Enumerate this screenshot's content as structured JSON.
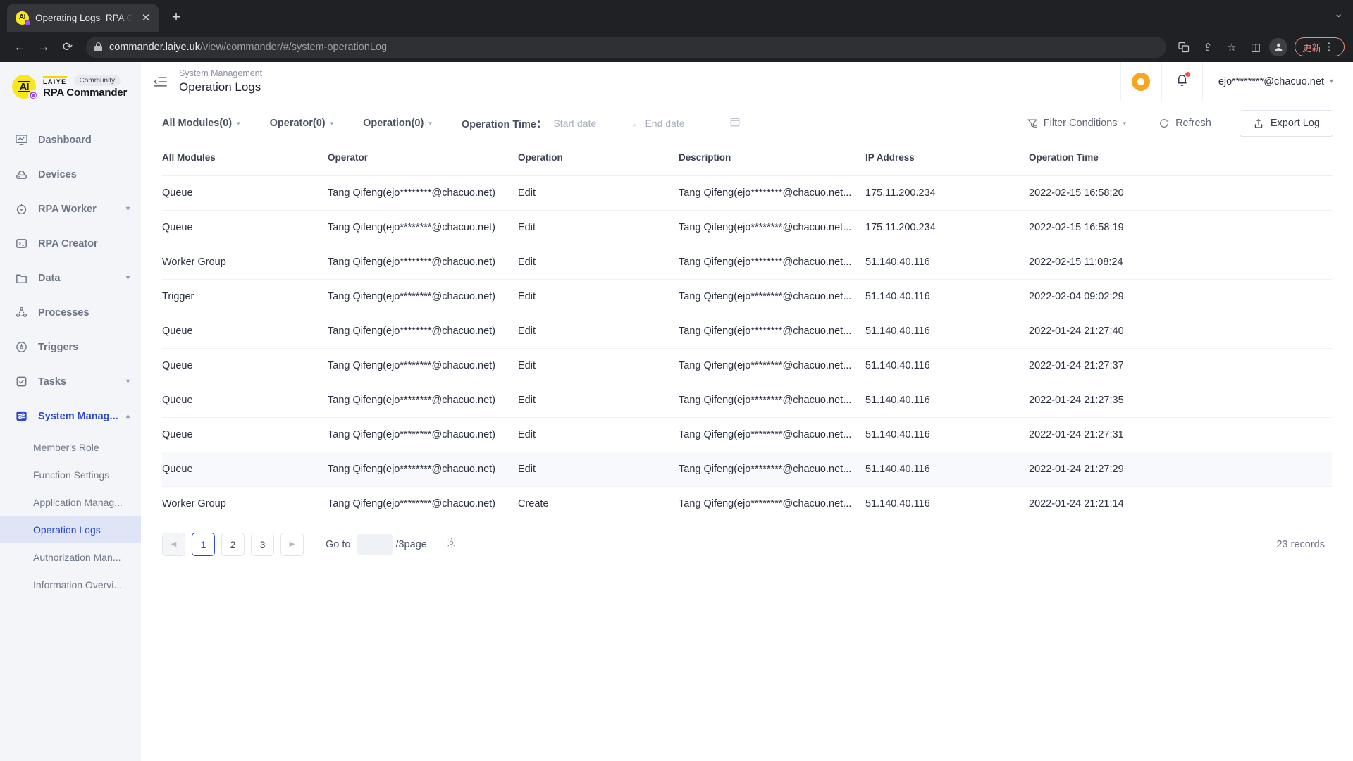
{
  "browser": {
    "tab_title": "Operating Logs_RPA Command",
    "tab_close": "✕",
    "new_tab": "+",
    "window_collapse": "⌄",
    "back": "←",
    "forward": "→",
    "reload": "⟳",
    "url_domain": "commander.laiye.uk",
    "url_path": "/view/commander/#/system-operationLog",
    "translate_icon": "translate-icon",
    "share_icon": "⇪",
    "bookmark_icon": "☆",
    "sidepanel_icon": "◫",
    "profile_icon": "●",
    "update_label": "更新",
    "menu_icon": "⋮"
  },
  "sidebar": {
    "logo": {
      "mark": "AI",
      "vendor": "LAIYE",
      "edition": "Community",
      "product": "RPA Commander"
    },
    "items": [
      {
        "label": "Dashboard",
        "icon": "dashboard-icon",
        "expandable": false,
        "active": false
      },
      {
        "label": "Devices",
        "icon": "device-icon",
        "expandable": false,
        "active": false
      },
      {
        "label": "RPA Worker",
        "icon": "robot-icon",
        "expandable": true,
        "active": false
      },
      {
        "label": "RPA Creator",
        "icon": "terminal-icon",
        "expandable": false,
        "active": false
      },
      {
        "label": "Data",
        "icon": "folder-icon",
        "expandable": true,
        "active": false
      },
      {
        "label": "Processes",
        "icon": "process-icon",
        "expandable": false,
        "active": false
      },
      {
        "label": "Triggers",
        "icon": "trigger-icon",
        "expandable": false,
        "active": false
      },
      {
        "label": "Tasks",
        "icon": "task-icon",
        "expandable": true,
        "active": false
      },
      {
        "label": "System Manag...",
        "icon": "settings-sliders-icon",
        "expandable": true,
        "active": true
      }
    ],
    "subitems": [
      {
        "label": "Member's Role",
        "active": false
      },
      {
        "label": "Function Settings",
        "active": false
      },
      {
        "label": "Application Manag...",
        "active": false
      },
      {
        "label": "Operation Logs",
        "active": true
      },
      {
        "label": "Authorization Man...",
        "active": false
      },
      {
        "label": "Information Overvi...",
        "active": false
      }
    ]
  },
  "header": {
    "breadcrumb": "System Management",
    "title": "Operation Logs",
    "collapse_icon": "collapse-sidebar-icon",
    "bulb_icon": "lightbulb-icon",
    "bell_icon": "🔔",
    "user_email": "ejo********@chacuo.net",
    "user_caret": "⌄"
  },
  "filters": {
    "modules": {
      "label": "All Modules(0)",
      "caret": "⌄"
    },
    "operator": {
      "label": "Operator(0)",
      "caret": "⌄"
    },
    "operation": {
      "label": "Operation(0)",
      "caret": "⌄"
    },
    "time_label": "Operation Time：",
    "start_placeholder": "Start date",
    "range_arrow": "→",
    "end_placeholder": "End date",
    "calendar_icon": "calendar-icon",
    "filter_conditions": {
      "label": "Filter Conditions",
      "caret": "⌄",
      "icon": "filter-icon"
    },
    "refresh": {
      "label": "Refresh",
      "icon": "refresh-icon"
    },
    "export": {
      "label": "Export Log",
      "icon": "export-icon"
    }
  },
  "table": {
    "columns": [
      "All Modules",
      "Operator",
      "Operation",
      "Description",
      "IP Address",
      "Operation Time"
    ],
    "rows": [
      {
        "module": "Queue",
        "operator": "Tang Qifeng(ejo********@chacuo.net)",
        "operation": "Edit",
        "description": "Tang Qifeng(ejo********@chacuo.net...",
        "ip": "175.11.200.234",
        "time": "2022-02-15 16:58:20",
        "hover": false
      },
      {
        "module": "Queue",
        "operator": "Tang Qifeng(ejo********@chacuo.net)",
        "operation": "Edit",
        "description": "Tang Qifeng(ejo********@chacuo.net...",
        "ip": "175.11.200.234",
        "time": "2022-02-15 16:58:19",
        "hover": false
      },
      {
        "module": "Worker Group",
        "operator": "Tang Qifeng(ejo********@chacuo.net)",
        "operation": "Edit",
        "description": "Tang Qifeng(ejo********@chacuo.net...",
        "ip": "51.140.40.116",
        "time": "2022-02-15 11:08:24",
        "hover": false
      },
      {
        "module": "Trigger",
        "operator": "Tang Qifeng(ejo********@chacuo.net)",
        "operation": "Edit",
        "description": "Tang Qifeng(ejo********@chacuo.net...",
        "ip": "51.140.40.116",
        "time": "2022-02-04 09:02:29",
        "hover": false
      },
      {
        "module": "Queue",
        "operator": "Tang Qifeng(ejo********@chacuo.net)",
        "operation": "Edit",
        "description": "Tang Qifeng(ejo********@chacuo.net...",
        "ip": "51.140.40.116",
        "time": "2022-01-24 21:27:40",
        "hover": false
      },
      {
        "module": "Queue",
        "operator": "Tang Qifeng(ejo********@chacuo.net)",
        "operation": "Edit",
        "description": "Tang Qifeng(ejo********@chacuo.net...",
        "ip": "51.140.40.116",
        "time": "2022-01-24 21:27:37",
        "hover": false
      },
      {
        "module": "Queue",
        "operator": "Tang Qifeng(ejo********@chacuo.net)",
        "operation": "Edit",
        "description": "Tang Qifeng(ejo********@chacuo.net...",
        "ip": "51.140.40.116",
        "time": "2022-01-24 21:27:35",
        "hover": false
      },
      {
        "module": "Queue",
        "operator": "Tang Qifeng(ejo********@chacuo.net)",
        "operation": "Edit",
        "description": "Tang Qifeng(ejo********@chacuo.net...",
        "ip": "51.140.40.116",
        "time": "2022-01-24 21:27:31",
        "hover": false
      },
      {
        "module": "Queue",
        "operator": "Tang Qifeng(ejo********@chacuo.net)",
        "operation": "Edit",
        "description": "Tang Qifeng(ejo********@chacuo.net...",
        "ip": "51.140.40.116",
        "time": "2022-01-24 21:27:29",
        "hover": true
      },
      {
        "module": "Worker Group",
        "operator": "Tang Qifeng(ejo********@chacuo.net)",
        "operation": "Create",
        "description": "Tang Qifeng(ejo********@chacuo.net...",
        "ip": "51.140.40.116",
        "time": "2022-01-24 21:21:14",
        "hover": false
      }
    ]
  },
  "pagination": {
    "prev": "◀",
    "pages": [
      "1",
      "2",
      "3"
    ],
    "current_page": "1",
    "next": "▶",
    "goto_label": "Go to",
    "goto_value": "",
    "per_page_label": "/3page",
    "settings_icon": "gear-icon",
    "records": "23 records"
  },
  "colors": {
    "accent": "#2b4acb",
    "brand_yellow": "#f8e71c",
    "sidebar_bg": "#f3f5f9",
    "chrome_bg": "#202124"
  }
}
